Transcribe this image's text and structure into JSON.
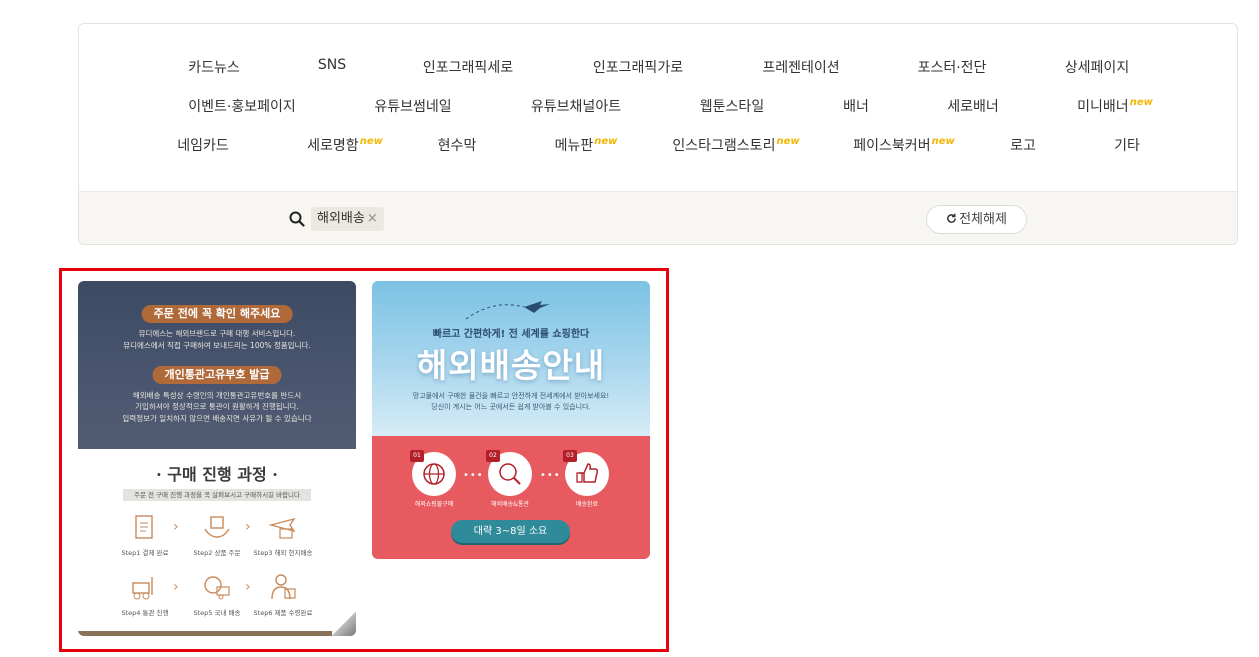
{
  "categories": {
    "row1": [
      "카드뉴스",
      "SNS",
      "인포그래픽세로",
      "인포그래픽가로",
      "프레젠테이션",
      "포스터·전단",
      "상세페이지"
    ],
    "row2": [
      "이벤트·홍보페이지",
      "유튜브썸네일",
      "유튜브채널아트",
      "웹툰스타일",
      "배너",
      "세로배너",
      "미니배너"
    ],
    "row3": [
      "네임카드",
      "세로명함",
      "현수막",
      "메뉴판",
      "인스타그램스토리",
      "페이스북커버",
      "로고",
      "기타"
    ],
    "new_badge": "new"
  },
  "filter": {
    "active_tag": "해외배송",
    "remove_symbol": "×",
    "reset_label": "전체해제"
  },
  "card1": {
    "pill1": "주문 전에 꼭 확인 해주세요",
    "text1a": "뮤디에스는 해외브랜드로 구매 대행 서비스입니다.",
    "text1b": "뮤디에스에서 직접 구매하여 보내드리는 100% 정품입니다.",
    "pill2": "개인통관고유부호 발급",
    "text2a": "해외배송 특성상 수령인의 개인통관고유번호를 반드시",
    "text2b": "기입하셔야 정상적으로 통관이 원활하게 진행됩니다.",
    "text2c": "입력정보가 일치하지 않으면 배송지연 사유가 될 수 있습니다",
    "process_title": "· 구매 진행 과정 ·",
    "process_sub": "주문 전 구매 진행 과정을 꼭 살펴보시고 구매하시길 바랍니다",
    "steps": [
      "Step1 결제 완료",
      "Step2 상품 주문",
      "Step3 해외 현지배송",
      "Step4 통관 진행",
      "Step5 국내 배송",
      "Step6 제품 수령완료"
    ]
  },
  "card2": {
    "sub": "빠르고 간편하게! 전 세계를 쇼핑한다",
    "title": "해외배송안내",
    "desc1": "망고몰에서 구매한 물건을 빠르고 안전하게 전세계에서 받아보세요!",
    "desc2": "당신이 계시는 어느 곳에서든 쉽게 받아볼 수 있습니다.",
    "step_nums": [
      "01",
      "02",
      "03"
    ],
    "step_labels": [
      "해외쇼핑몰구매",
      "해외배송&통관",
      "배송완료"
    ],
    "button": "대략 3~8일 소요"
  },
  "colors": {
    "highlight": "#e8000b",
    "new_badge": "#f2b705",
    "card2_bottom": "#e75a5f",
    "card1_pill": "#b06a3a"
  }
}
